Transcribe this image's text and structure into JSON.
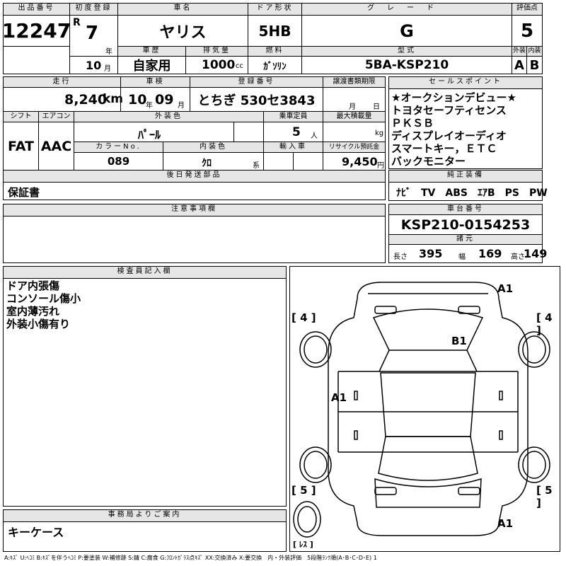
{
  "top": {
    "lot_no_label": "出品番号",
    "lot_no": "12247",
    "first_reg_label": "初度登録",
    "era": "R",
    "year": "7",
    "year_unit": "年",
    "month": "10",
    "month_unit": "月",
    "car_name_label": "車名",
    "car_name": "ヤリス",
    "door_label": "ドア形状",
    "door": "5HB",
    "grade_label": "グレード",
    "grade": "G",
    "score_label": "評価点",
    "score": "5",
    "history_label": "車歴",
    "history": "自家用",
    "displacement_label": "排気量",
    "displacement": "1000",
    "cc": "cc",
    "fuel_label": "燃料",
    "fuel": "ｶﾞｿﾘﾝ",
    "model_label": "型式",
    "model": "5BA-KSP210",
    "ext_label": "外装",
    "ext": "A",
    "int_label": "内装",
    "int": "B"
  },
  "mid": {
    "mileage_label": "走行",
    "mileage": "8,240",
    "km": "km",
    "inspection_label": "車検",
    "insp_year": "10",
    "insp_year_unit": "年",
    "insp_month": "09",
    "insp_month_unit": "月",
    "plate_label": "登録番号",
    "plate": "とちぎ 530セ3843",
    "transfer_label": "譲渡書類期限",
    "transfer_month_unit": "月",
    "transfer_day_unit": "日",
    "shift_label": "シフト",
    "shift": "FAT",
    "ac_label": "エアコン",
    "ac": "AAC",
    "ext_color_label": "外装色",
    "ext_color": "ﾊﾟｰﾙ",
    "seats_label": "乗車定員",
    "seats": "5",
    "seats_unit": "人",
    "load_label": "最大積載量",
    "load_unit": "kg",
    "color_no_label": "カラーNo.",
    "color_no": "089",
    "int_color_label": "内装色",
    "int_color": "ｸﾛ",
    "int_color_unit": "系",
    "import_label": "輸入車",
    "recycle_label": "リサイクル預託金",
    "recycle": "9,450",
    "recycle_unit": "円",
    "later_label": "後日発送部品",
    "later": "保証書"
  },
  "sales": {
    "label": "セールスポイント",
    "lines": [
      "★オークションデビュー★",
      "トヨタセーフティセンス",
      "ＰＫＳＢ",
      "ディスプレイオーディオ",
      "スマートキー，ＥＴＣ",
      "バックモニター"
    ]
  },
  "equip": {
    "label": "純正装備",
    "value": "ﾅﾋﾞ　TV　ABS　ｴｱB　PS　PW"
  },
  "notes": {
    "label": "注意事項欄"
  },
  "chassis": {
    "label": "車台番号",
    "value": "KSP210-0154253",
    "dims_label": "諸元",
    "len_label": "長さ",
    "len": "395",
    "wid_label": "幅",
    "wid": "169",
    "hgt_label": "高さ",
    "hgt": "149"
  },
  "inspector": {
    "label": "検査員記入欄",
    "lines": [
      "ドア内張傷",
      "コンソール傷小",
      "室内薄汚れ",
      "外装小傷有り"
    ]
  },
  "office": {
    "label": "事務局よりご案内",
    "value": "キーケース"
  },
  "diagram": {
    "marks": [
      "A1",
      "B1",
      "A1",
      "A1"
    ],
    "tires": [
      "4",
      "4",
      "5",
      "5",
      "ﾚｽ"
    ]
  },
  "legend": "A:ｷｽﾞ U:ﾍｺﾐ B:ｷｽﾞを伴うﾍｺﾐ P:要塗装 W:補修跡 S:錆 C:腐食 G:ﾌﾛﾝﾄｶﾞﾗｽ点ｷｽﾞ XX:交換済み X:要交換　内・外装評価　5段階ﾗﾝｸ順(A･B･C･D･E) 1"
}
